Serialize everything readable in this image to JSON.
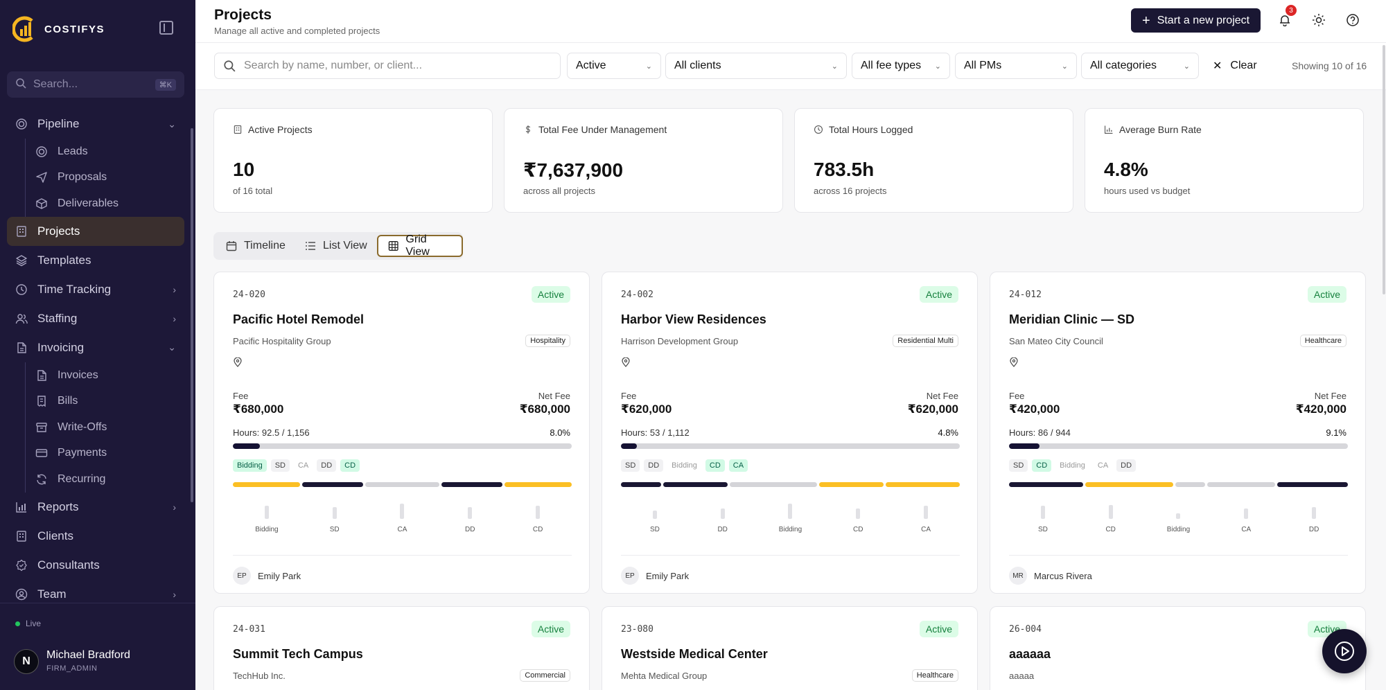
{
  "brand": {
    "name": "COSTIFYS"
  },
  "sidebar": {
    "search_placeholder": "Search...",
    "search_shortcut": "⌘K",
    "items": [
      {
        "label": "Pipeline",
        "icon": "target-icon",
        "expanded": true
      },
      {
        "label": "Leads",
        "icon": "target-icon",
        "sub": true
      },
      {
        "label": "Proposals",
        "icon": "send-icon",
        "sub": true
      },
      {
        "label": "Deliverables",
        "icon": "box-icon",
        "sub": true
      },
      {
        "label": "Projects",
        "icon": "building-icon",
        "active": true
      },
      {
        "label": "Templates",
        "icon": "layers-icon"
      },
      {
        "label": "Time Tracking",
        "icon": "clock-icon",
        "collapsed": true
      },
      {
        "label": "Staffing",
        "icon": "users-icon",
        "collapsed": true
      },
      {
        "label": "Invoicing",
        "icon": "file-icon",
        "expanded": true
      },
      {
        "label": "Invoices",
        "icon": "file-icon",
        "sub": true
      },
      {
        "label": "Bills",
        "icon": "receipt-icon",
        "sub": true
      },
      {
        "label": "Write-Offs",
        "icon": "archive-icon",
        "sub": true
      },
      {
        "label": "Payments",
        "icon": "card-icon",
        "sub": true
      },
      {
        "label": "Recurring",
        "icon": "refresh-icon",
        "sub": true
      },
      {
        "label": "Reports",
        "icon": "chart-icon",
        "collapsed": true
      },
      {
        "label": "Clients",
        "icon": "building-icon"
      },
      {
        "label": "Consultants",
        "icon": "badge-icon"
      },
      {
        "label": "Team",
        "icon": "user-circle-icon",
        "collapsed": true
      }
    ],
    "status": "Live",
    "user": {
      "initial": "N",
      "name": "Michael Bradford",
      "role": "FIRM_ADMIN"
    }
  },
  "header": {
    "title": "Projects",
    "subtitle": "Manage all active and completed projects",
    "new_button": "Start a new project",
    "notification_count": "3"
  },
  "filters": {
    "search_placeholder": "Search by name, number, or client...",
    "status": "Active",
    "clients": "All clients",
    "fee_types": "All fee types",
    "pms": "All PMs",
    "categories": "All categories",
    "clear": "Clear",
    "showing": "Showing 10 of 16"
  },
  "stats": [
    {
      "label": "Active Projects",
      "icon": "building-icon",
      "value": "10",
      "sub": "of 16 total"
    },
    {
      "label": "Total Fee Under Management",
      "icon": "dollar-icon",
      "value": "₹7,637,900",
      "sub": "across all projects"
    },
    {
      "label": "Total Hours Logged",
      "icon": "clock-icon",
      "value": "783.5h",
      "sub": "across 16 projects"
    },
    {
      "label": "Average Burn Rate",
      "icon": "bar-chart-icon",
      "value": "4.8%",
      "sub": "hours used vs budget"
    }
  ],
  "views": {
    "timeline": "Timeline",
    "list": "List View",
    "grid": "Grid View",
    "selected": "grid"
  },
  "labels": {
    "fee": "Fee",
    "net_fee": "Net Fee"
  },
  "colors": {
    "dark": "#1a1733",
    "yellow": "#fbbf24",
    "gray": "#d4d4d8",
    "active_green": "#dcfce7"
  },
  "projects": [
    {
      "number": "24-020",
      "status": "Active",
      "name": "Pacific Hotel Remodel",
      "client": "Pacific Hospitality Group",
      "category": "Hospitality",
      "fee": "₹680,000",
      "net_fee": "₹680,000",
      "hours": "Hours: 92.5 / 1,156",
      "burn": "8.0%",
      "burn_value": 0.08,
      "chips": [
        {
          "t": "Bidding",
          "s": "green"
        },
        {
          "t": "SD",
          "s": ""
        },
        {
          "t": "CA",
          "s": "ghost"
        },
        {
          "t": "DD",
          "s": ""
        },
        {
          "t": "CD",
          "s": "green"
        }
      ],
      "segments": [
        {
          "w": 20,
          "c": "yellow"
        },
        {
          "w": 18,
          "c": "dark"
        },
        {
          "w": 22,
          "c": "gray"
        },
        {
          "w": 18,
          "c": "dark"
        },
        {
          "w": 20,
          "c": "yellow"
        }
      ],
      "phases": [
        {
          "t": "Bidding",
          "v": 0.55
        },
        {
          "t": "SD",
          "v": 0.5
        },
        {
          "t": "CA",
          "v": 0.65
        },
        {
          "t": "DD",
          "v": 0.5
        },
        {
          "t": "CD",
          "v": 0.55
        }
      ],
      "pm_initials": "EP",
      "pm": "Emily Park"
    },
    {
      "number": "24-002",
      "status": "Active",
      "name": "Harbor View Residences",
      "client": "Harrison Development Group",
      "category": "Residential Multi",
      "fee": "₹620,000",
      "net_fee": "₹620,000",
      "hours": "Hours: 53 / 1,112",
      "burn": "4.8%",
      "burn_value": 0.048,
      "chips": [
        {
          "t": "SD",
          "s": ""
        },
        {
          "t": "DD",
          "s": ""
        },
        {
          "t": "Bidding",
          "s": "ghost"
        },
        {
          "t": "CD",
          "s": "green"
        },
        {
          "t": "CA",
          "s": "green"
        }
      ],
      "segments": [
        {
          "w": 12,
          "c": "dark"
        },
        {
          "w": 19,
          "c": "dark"
        },
        {
          "w": 26,
          "c": "gray"
        },
        {
          "w": 19,
          "c": "yellow"
        },
        {
          "w": 22,
          "c": "yellow"
        }
      ],
      "phases": [
        {
          "t": "SD",
          "v": 0.35
        },
        {
          "t": "DD",
          "v": 0.45
        },
        {
          "t": "Bidding",
          "v": 0.65
        },
        {
          "t": "CD",
          "v": 0.45
        },
        {
          "t": "CA",
          "v": 0.55
        }
      ],
      "pm_initials": "EP",
      "pm": "Emily Park"
    },
    {
      "number": "24-012",
      "status": "Active",
      "name": "Meridian Clinic — SD",
      "client": "San Mateo City Council",
      "category": "Healthcare",
      "fee": "₹420,000",
      "net_fee": "₹420,000",
      "hours": "Hours: 86 / 944",
      "burn": "9.1%",
      "burn_value": 0.091,
      "chips": [
        {
          "t": "SD",
          "s": ""
        },
        {
          "t": "CD",
          "s": "green"
        },
        {
          "t": "Bidding",
          "s": "ghost"
        },
        {
          "t": "CA",
          "s": "ghost"
        },
        {
          "t": "DD",
          "s": ""
        }
      ],
      "segments": [
        {
          "w": 22,
          "c": "dark"
        },
        {
          "w": 26,
          "c": "yellow"
        },
        {
          "w": 9,
          "c": "gray"
        },
        {
          "w": 20,
          "c": "gray"
        },
        {
          "w": 21,
          "c": "dark"
        }
      ],
      "phases": [
        {
          "t": "SD",
          "v": 0.55
        },
        {
          "t": "CD",
          "v": 0.6
        },
        {
          "t": "Bidding",
          "v": 0.25
        },
        {
          "t": "CA",
          "v": 0.45
        },
        {
          "t": "DD",
          "v": 0.5
        }
      ],
      "pm_initials": "MR",
      "pm": "Marcus Rivera"
    },
    {
      "number": "24-031",
      "status": "Active",
      "name": "Summit Tech Campus",
      "client": "TechHub Inc.",
      "category": "Commercial"
    },
    {
      "number": "23-080",
      "status": "Active",
      "name": "Westside Medical Center",
      "client": "Mehta Medical Group",
      "category": "Healthcare"
    },
    {
      "number": "26-004",
      "status": "Active",
      "name": "aaaaaa",
      "client": "aaaaa",
      "category": ""
    }
  ]
}
